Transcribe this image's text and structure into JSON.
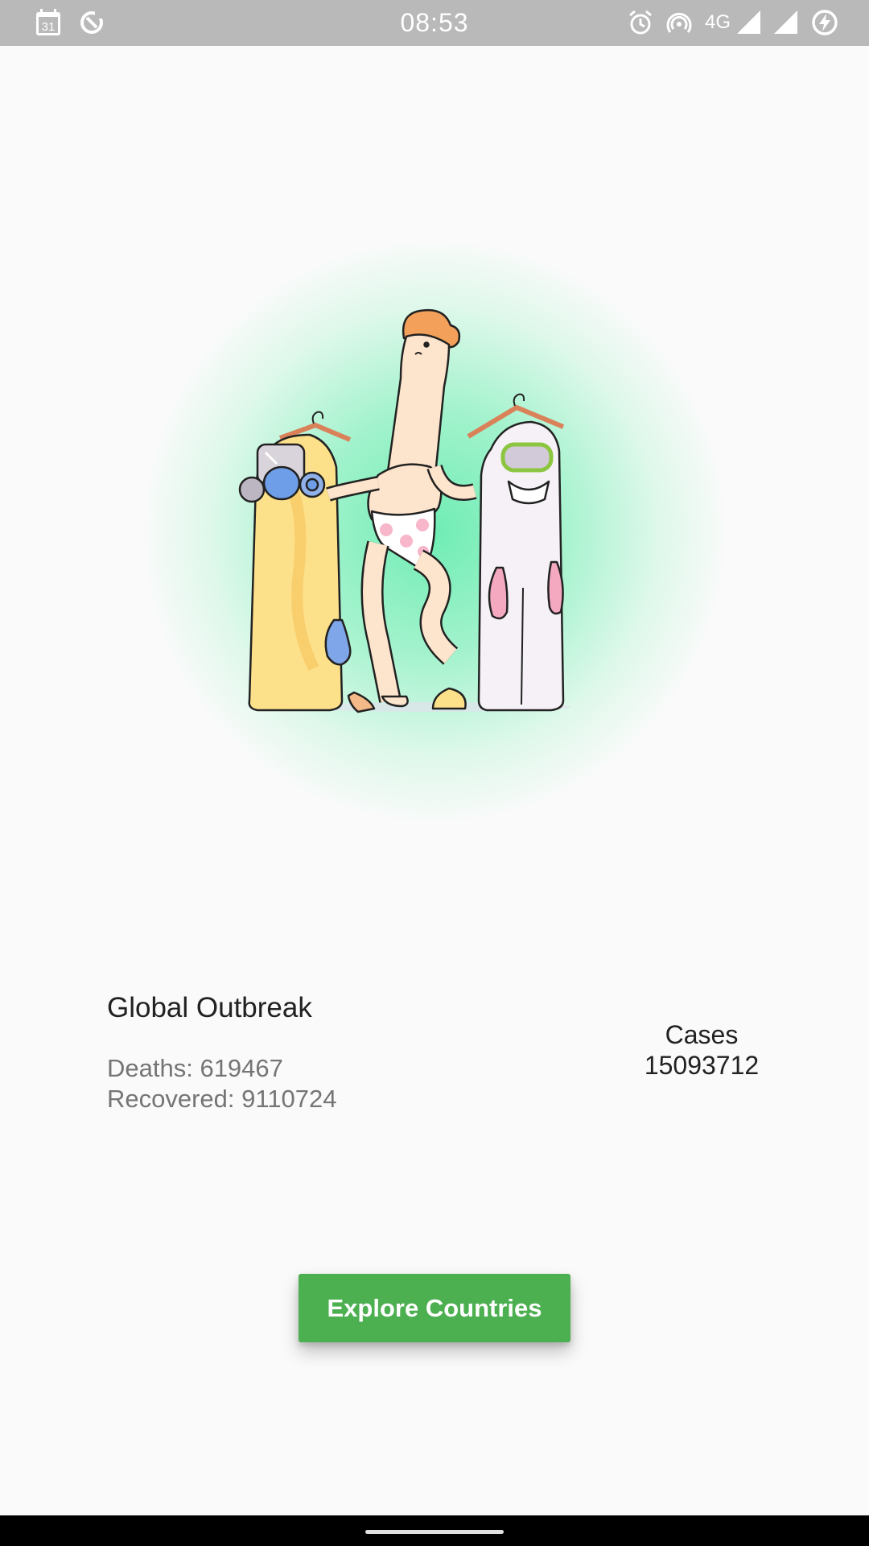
{
  "status_bar": {
    "time": "08:53",
    "calendar_day": "31",
    "network_label": "4G",
    "icons": [
      "calendar-icon",
      "data-saver-icon",
      "alarm-icon",
      "hotspot-icon",
      "signal-icon",
      "signal-icon",
      "battery-charging-icon"
    ],
    "background": "#b9b9b9"
  },
  "hero": {
    "illustration": "people-with-protective-suits-illustration"
  },
  "global": {
    "title": "Global Outbreak",
    "deaths": "Deaths: 619467",
    "recovered": "Recovered: 9110724",
    "cases_label": "Cases",
    "cases_value": "15093712"
  },
  "actions": {
    "explore_label": "Explore Countries",
    "button_color": "#4caf50"
  }
}
